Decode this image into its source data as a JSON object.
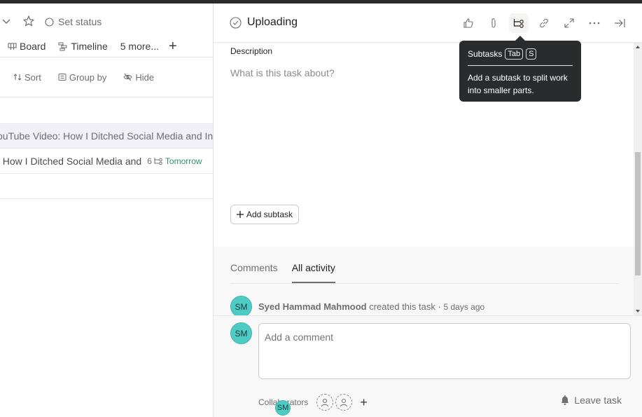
{
  "project_header": {
    "set_status_label": "Set status"
  },
  "views": {
    "items": [
      {
        "label": "Board",
        "icon": "board-icon"
      },
      {
        "label": "Timeline",
        "icon": "timeline-icon"
      },
      {
        "label": "5 more..."
      }
    ],
    "add_label": "+"
  },
  "toolbar": {
    "sort_label": "Sort",
    "group_by_label": "Group by",
    "hide_label": "Hide"
  },
  "tasks": [
    {
      "name": "ouTube Video: How I Ditched Social Media and In",
      "selected": true
    },
    {
      "name": ": How I Ditched Social Media and",
      "subtask_count": "6",
      "due": "Tomorrow"
    }
  ],
  "detail": {
    "title": "Uploading",
    "header_icons": [
      "like-icon",
      "attachment-icon",
      "subtasks-icon",
      "link-icon",
      "expand-icon",
      "more-icon",
      "close-pane-icon"
    ],
    "description_label": "Description",
    "description_placeholder": "What is this task about?",
    "add_subtask_label": "Add subtask"
  },
  "tooltip": {
    "title": "Subtasks",
    "keys": [
      "Tab",
      "S"
    ],
    "body": "Add a subtask to split work into smaller parts."
  },
  "activity": {
    "tabs": [
      {
        "label": "Comments",
        "active": false
      },
      {
        "label": "All activity",
        "active": true
      }
    ],
    "story": {
      "avatar": "SM",
      "author": "Syed Hammad Mahmood",
      "action": "created this task",
      "separator": "·",
      "time": "5 days ago"
    }
  },
  "composer": {
    "avatar": "SM",
    "placeholder": "Add a comment",
    "collaborators_label": "Collaborators",
    "collaborator_avatar": "SM",
    "add_collaborator": "+",
    "leave_label": "Leave task"
  },
  "colors": {
    "avatar": "#4ecbc4",
    "due_date": "#2e8f6f",
    "tooltip_bg": "#2a2b2d"
  }
}
